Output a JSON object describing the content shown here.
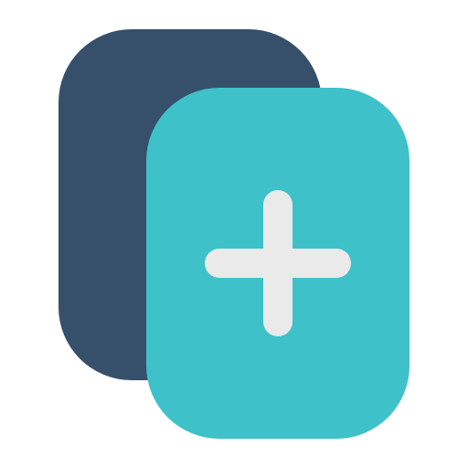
{
  "icon": {
    "name": "add-document-icon",
    "colors": {
      "back_card": "#36506B",
      "front_card": "#3EC1C9",
      "plus": "#EAEAEA",
      "background": "#FFFFFF"
    }
  }
}
